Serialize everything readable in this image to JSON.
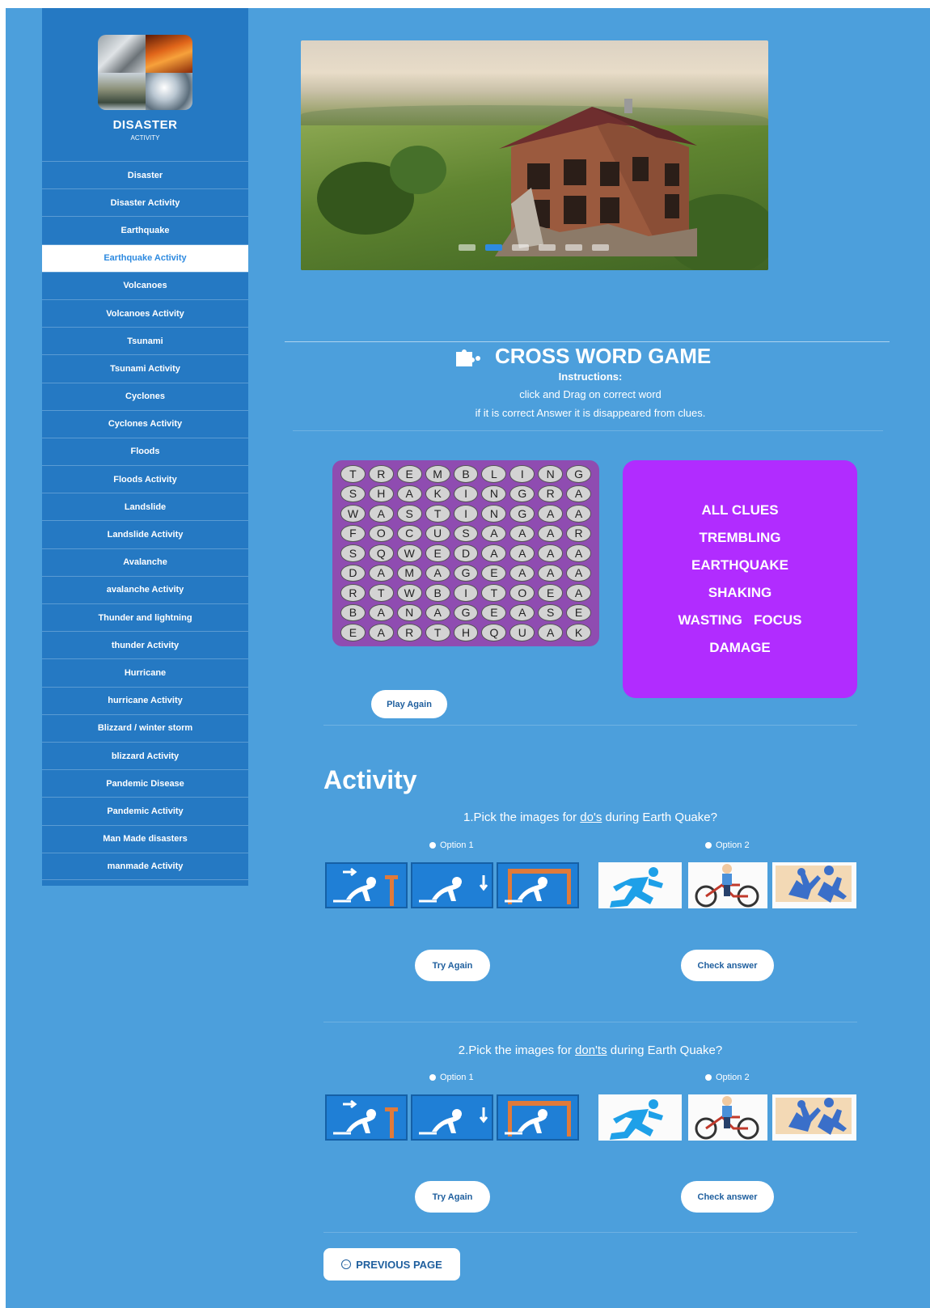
{
  "sidebar": {
    "brand_title": "DISASTER",
    "brand_subtitle": "ACTIVITY",
    "items": [
      {
        "label": "Disaster"
      },
      {
        "label": "Disaster Activity"
      },
      {
        "label": "Earthquake"
      },
      {
        "label": "Earthquake Activity",
        "active": true
      },
      {
        "label": "Volcanoes"
      },
      {
        "label": "Volcanoes Activity"
      },
      {
        "label": "Tsunami"
      },
      {
        "label": "Tsunami Activity"
      },
      {
        "label": "Cyclones"
      },
      {
        "label": "Cyclones Activity"
      },
      {
        "label": "Floods"
      },
      {
        "label": "Floods Activity"
      },
      {
        "label": "Landslide"
      },
      {
        "label": "Landslide Activity"
      },
      {
        "label": "Avalanche"
      },
      {
        "label": "avalanche Activity"
      },
      {
        "label": "Thunder and lightning"
      },
      {
        "label": "thunder Activity"
      },
      {
        "label": "Hurricane"
      },
      {
        "label": "hurricane Activity"
      },
      {
        "label": "Blizzard / winter storm"
      },
      {
        "label": "blizzard Activity"
      },
      {
        "label": "Pandemic Disease"
      },
      {
        "label": "Pandemic Activity"
      },
      {
        "label": "Man Made disasters"
      },
      {
        "label": "manmade Activity"
      }
    ]
  },
  "slider": {
    "dot_count": 6,
    "active_dot": 2
  },
  "crossword": {
    "title": "CROSS WORD GAME",
    "icon": "puzzle-icon",
    "instructions_label": "Instructions:",
    "instruction_1": "click and Drag on correct word",
    "instruction_2": "if it is correct Answer it is disappeared from clues.",
    "grid": [
      [
        "T",
        "R",
        "E",
        "M",
        "B",
        "L",
        "I",
        "N",
        "G"
      ],
      [
        "S",
        "H",
        "A",
        "K",
        "I",
        "N",
        "G",
        "R",
        "A"
      ],
      [
        "W",
        "A",
        "S",
        "T",
        "I",
        "N",
        "G",
        "A",
        "A"
      ],
      [
        "F",
        "O",
        "C",
        "U",
        "S",
        "A",
        "A",
        "A",
        "R"
      ],
      [
        "S",
        "Q",
        "W",
        "E",
        "D",
        "A",
        "A",
        "A",
        "A"
      ],
      [
        "D",
        "A",
        "M",
        "A",
        "G",
        "E",
        "A",
        "A",
        "A"
      ],
      [
        "R",
        "T",
        "W",
        "B",
        "I",
        "T",
        "O",
        "E",
        "A"
      ],
      [
        "B",
        "A",
        "N",
        "A",
        "G",
        "E",
        "A",
        "S",
        "E"
      ],
      [
        "E",
        "A",
        "R",
        "T",
        "H",
        "Q",
        "U",
        "A",
        "K"
      ]
    ],
    "clues_title": "ALL CLUES",
    "clues": [
      "TREMBLING",
      "EARTHQUAKE",
      "SHAKING",
      "WASTING   FOCUS",
      "DAMAGE"
    ],
    "play_again_label": "Play Again"
  },
  "activity": {
    "title": "Activity",
    "questions": [
      {
        "prefix": "1.Pick the images for ",
        "keyword": "do's",
        "suffix": " during Earth Quake?",
        "option1_label": "Option 1",
        "option2_label": "Option 2",
        "try_again_label": "Try Again",
        "check_label": "Check answer"
      },
      {
        "prefix": "2.Pick the images for ",
        "keyword": "don'ts",
        "suffix": " during Earth Quake?",
        "option1_label": "Option 1",
        "option2_label": "Option 2",
        "try_again_label": "Try Again",
        "check_label": "Check answer"
      }
    ],
    "previous_page_label": "PREVIOUS PAGE"
  },
  "colors": {
    "page_bg": "#4c9fdc",
    "sidebar_bg": "#2579c3",
    "clues_bg": "#b12cff",
    "grid_bg": "#8f4cb1",
    "active_nav_text": "#2d8ae0"
  }
}
